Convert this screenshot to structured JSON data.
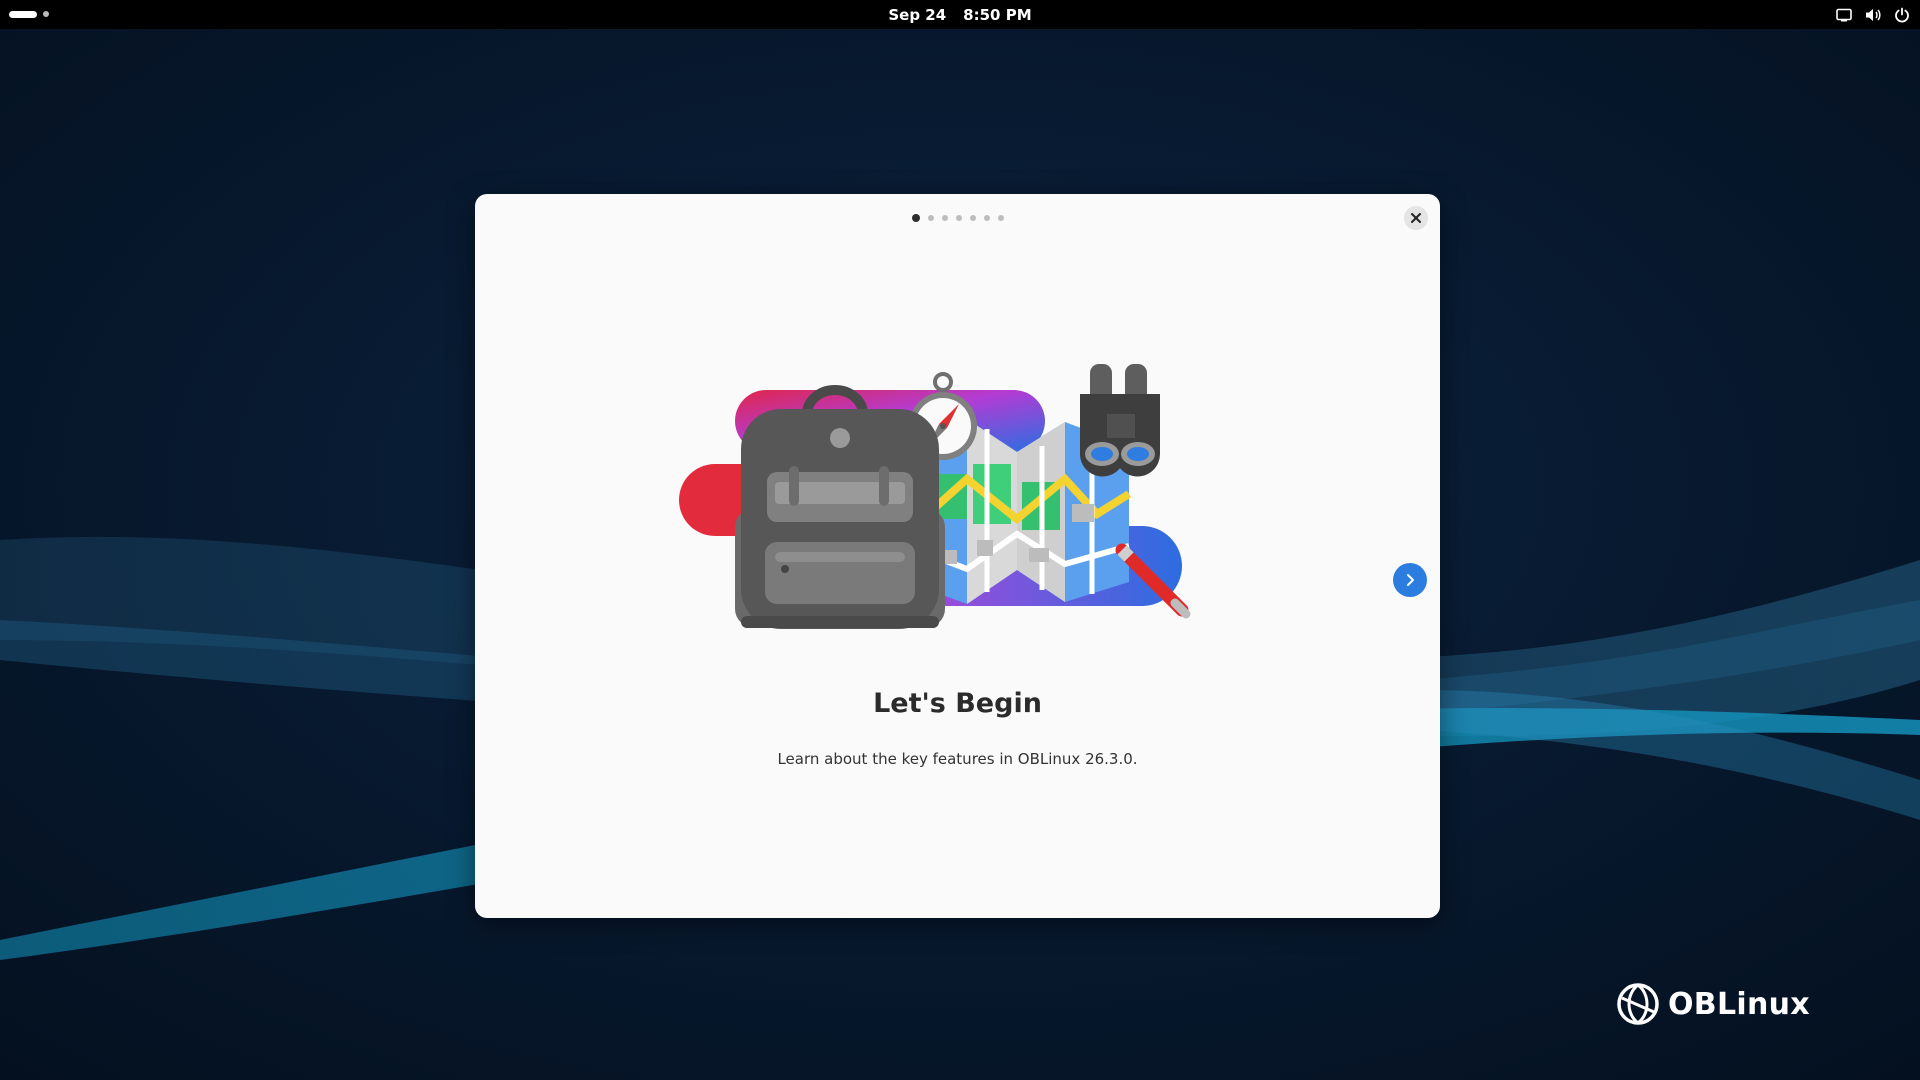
{
  "topbar": {
    "date": "Sep 24",
    "time": "8:50 PM",
    "tray_icons": [
      "screen-icon",
      "volume-icon",
      "power-icon"
    ]
  },
  "dialog": {
    "page_count": 7,
    "current_page": 1,
    "title": "Let's Begin",
    "description": "Learn about the key features in OBLinux 26.3.0."
  },
  "brand": {
    "name": "OBLinux"
  },
  "colors": {
    "accent": "#2b7de0",
    "topbar": "#000000",
    "dialog_bg": "#fafafa",
    "wallpaper": "#061428"
  }
}
